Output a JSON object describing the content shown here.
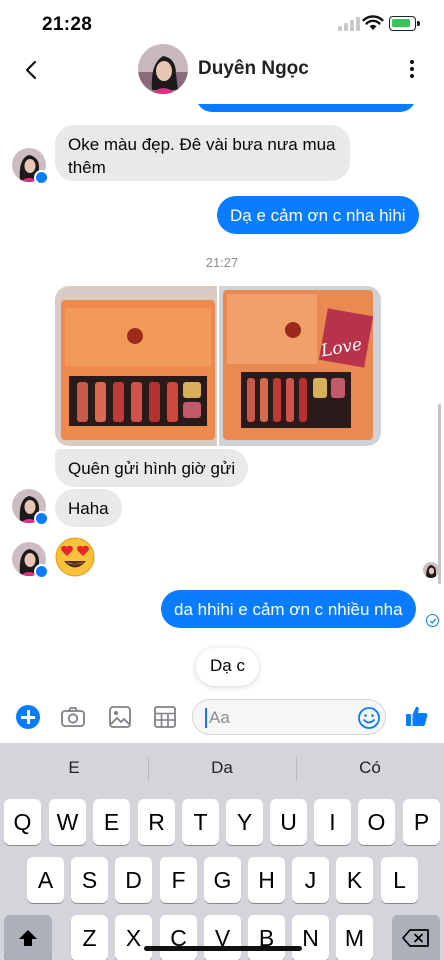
{
  "status_bar": {
    "time": "21:28"
  },
  "header": {
    "contact_name": "Duyên Ngọc"
  },
  "messages": {
    "m1": "Oke màu đẹp. Đê vài bưa nưa mua",
    "m1b": "thêm",
    "m2": "Dạ e cảm ơn c nha hihi",
    "timestamp": "21:27",
    "m3": "Quên gửi hình giờ gửi",
    "m4": "Haha",
    "m5": "da hhihi e cảm ơn c nhiều nha",
    "draft_chip": "Dạ c"
  },
  "photo_labels": {
    "love_card": "Love"
  },
  "composer": {
    "placeholder": "Aa"
  },
  "keyboard": {
    "suggestions": [
      "E",
      "Da",
      "Có"
    ],
    "row1": [
      "Q",
      "W",
      "E",
      "R",
      "T",
      "Y",
      "U",
      "I",
      "O",
      "P"
    ],
    "row2": [
      "A",
      "S",
      "D",
      "F",
      "G",
      "H",
      "J",
      "K",
      "L"
    ],
    "row3": [
      "Z",
      "X",
      "C",
      "V",
      "B",
      "N",
      "M"
    ]
  },
  "colors": {
    "accent": "#0a7cff",
    "incoming_bubble": "#e9e9eb",
    "keyboard_bg": "#d3d5db"
  }
}
